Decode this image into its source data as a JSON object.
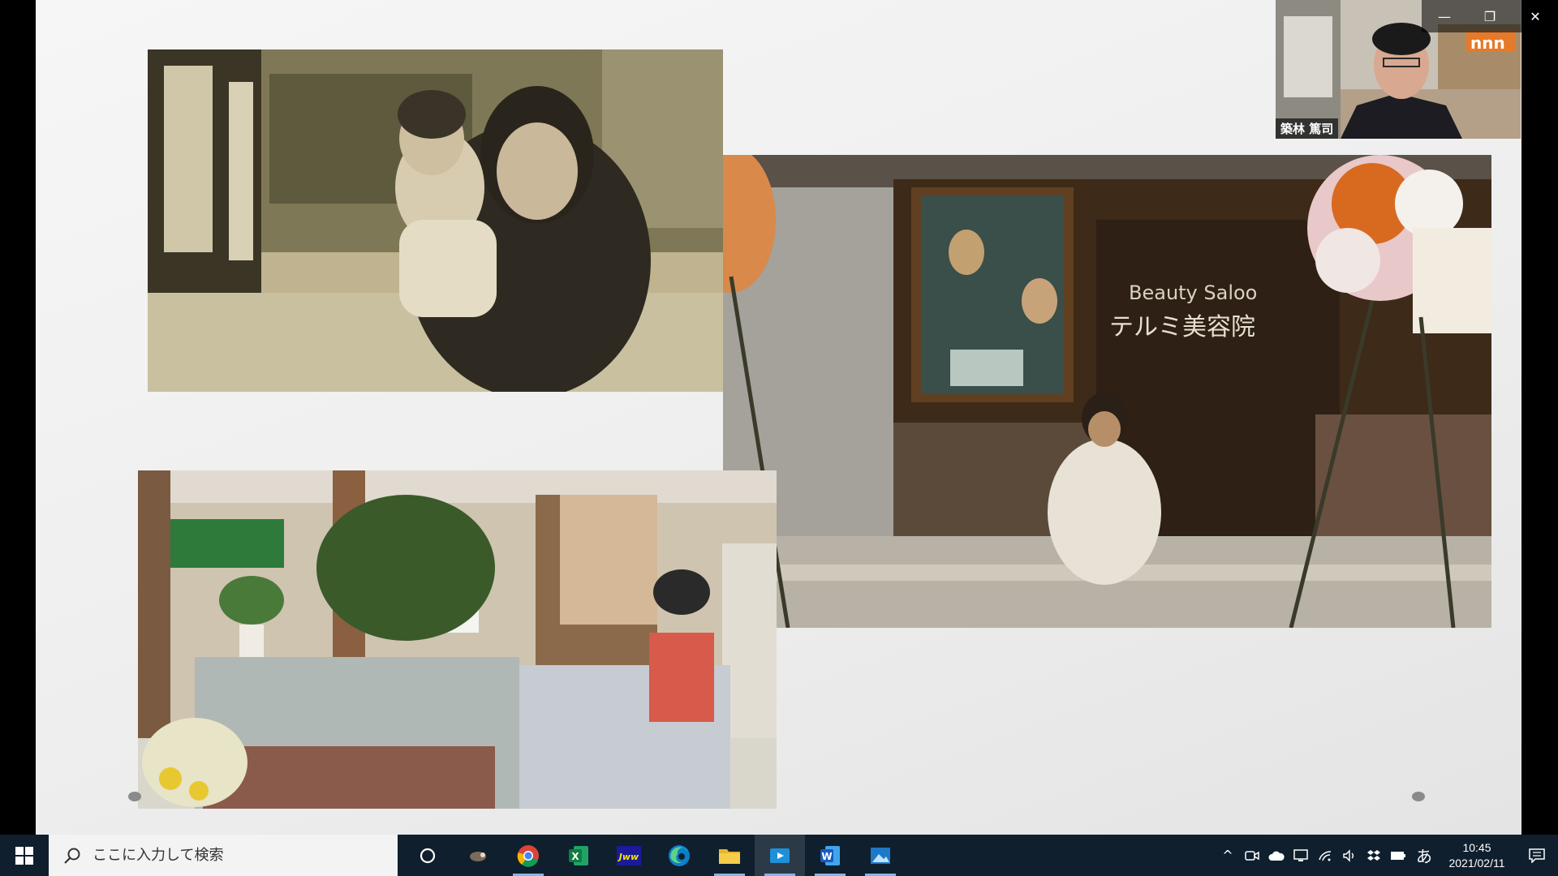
{
  "slide": {
    "photo_storefront": {
      "sign_line1": "Beauty Saloo",
      "sign_line2": "テルミ美容院"
    }
  },
  "video": {
    "participant_name": "築林 篤司",
    "logo_text": "nnn"
  },
  "window_controls": {
    "minimize_icon": "minimize-icon",
    "restore_icon": "restore-icon",
    "close_icon": "close-icon"
  },
  "taskbar": {
    "search_placeholder": "ここに入力して検索",
    "apps": [
      {
        "name": "cortana",
        "icon": "cortana-ring-icon"
      },
      {
        "name": "taskview",
        "icon": "app-icon"
      },
      {
        "name": "chrome",
        "icon": "chrome-icon"
      },
      {
        "name": "excel",
        "icon": "excel-icon",
        "label": "X"
      },
      {
        "name": "jww",
        "icon": "jww-icon",
        "label": "Jww"
      },
      {
        "name": "edge",
        "icon": "edge-icon"
      },
      {
        "name": "file-explorer",
        "icon": "folder-icon"
      },
      {
        "name": "video-app",
        "icon": "video-app-icon"
      },
      {
        "name": "word",
        "icon": "word-icon",
        "label": "W"
      },
      {
        "name": "photos",
        "icon": "photos-icon"
      }
    ],
    "tray": {
      "chevron": "^",
      "ime_label": "あ",
      "time": "10:45",
      "date": "2021/02/11"
    }
  },
  "colors": {
    "taskbar_bg": "#0f1f2e",
    "slide_bg": "#eeeeee",
    "accent": "#8ab4e8"
  }
}
